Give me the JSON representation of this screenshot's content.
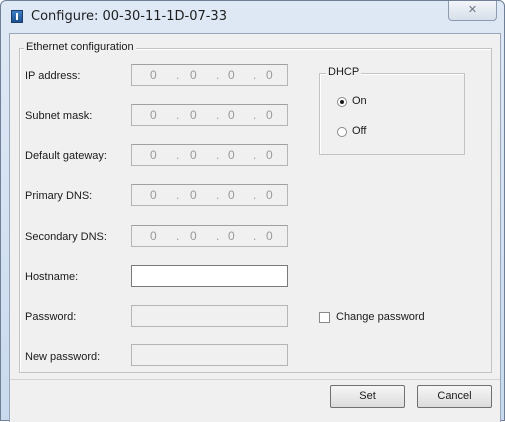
{
  "window": {
    "title": "Configure: 00-30-11-1D-07-33",
    "close_glyph": "✕"
  },
  "ethernet": {
    "group_title": "Ethernet configuration",
    "ip_label": "IP address:",
    "subnet_label": "Subnet mask:",
    "gateway_label": "Default gateway:",
    "primary_dns_label": "Primary DNS:",
    "secondary_dns_label": "Secondary DNS:",
    "hostname_label": "Hostname:",
    "password_label": "Password:",
    "new_password_label": "New password:",
    "ip_octets": [
      "0",
      "0",
      "0",
      "0"
    ],
    "subnet_octets": [
      "0",
      "0",
      "0",
      "0"
    ],
    "gateway_octets": [
      "0",
      "0",
      "0",
      "0"
    ],
    "primary_dns_octets": [
      "0",
      "0",
      "0",
      "0"
    ],
    "secondary_dns_octets": [
      "0",
      "0",
      "0",
      "0"
    ],
    "dot": ".",
    "hostname_value": "",
    "password_value": "",
    "new_password_value": ""
  },
  "dhcp": {
    "group_title": "DHCP",
    "on_label": "On",
    "off_label": "Off",
    "selected": "On"
  },
  "change_password": {
    "label": "Change password",
    "checked": false
  },
  "buttons": {
    "set": "Set",
    "cancel": "Cancel"
  },
  "colors": {
    "title_bar": "#dfe9f5",
    "dialog_bg": "#f0f0f0"
  }
}
